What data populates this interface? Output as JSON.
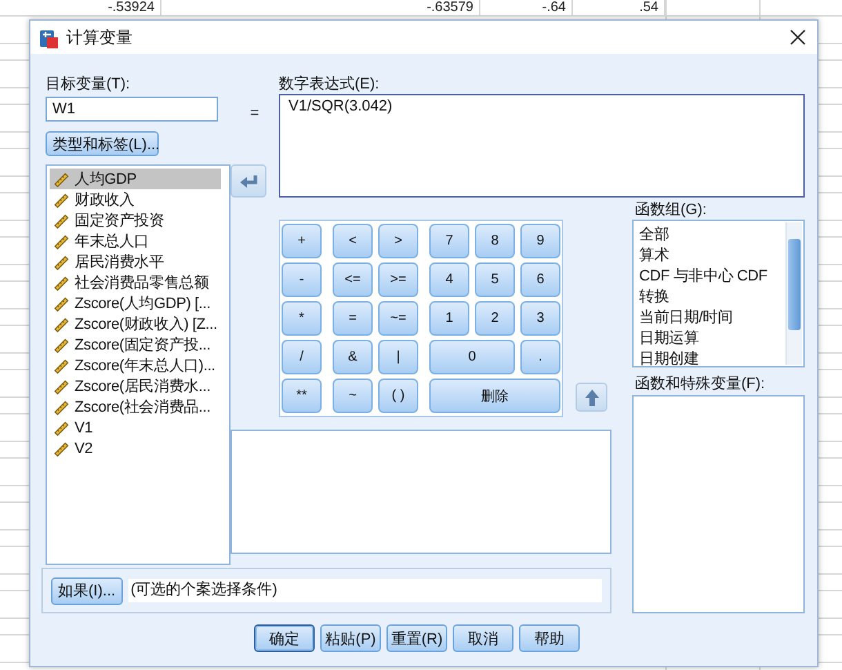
{
  "spreadsheet": {
    "cells": [
      "-.53924",
      "-.63579",
      "-.64",
      ".54"
    ]
  },
  "dialog": {
    "title": "计算变量",
    "target": {
      "label": "目标变量(T):",
      "value": "W1"
    },
    "equals": "=",
    "type_button": "类型和标签(L)...",
    "variables": [
      {
        "label": "人均GDP",
        "selected": true
      },
      {
        "label": "财政收入",
        "selected": false
      },
      {
        "label": "固定资产投资",
        "selected": false
      },
      {
        "label": "年末总人口",
        "selected": false
      },
      {
        "label": "居民消费水平",
        "selected": false
      },
      {
        "label": "社会消费品零售总额",
        "selected": false
      },
      {
        "label": "Zscore(人均GDP) [...",
        "selected": false
      },
      {
        "label": "Zscore(财政收入) [Z...",
        "selected": false
      },
      {
        "label": "Zscore(固定资产投...",
        "selected": false
      },
      {
        "label": "Zscore(年末总人口)...",
        "selected": false
      },
      {
        "label": "Zscore(居民消费水...",
        "selected": false
      },
      {
        "label": "Zscore(社会消费品...",
        "selected": false
      },
      {
        "label": "V1",
        "selected": false
      },
      {
        "label": "V2",
        "selected": false
      }
    ],
    "expression": {
      "label": "数字表达式(E):",
      "value": "V1/SQR(3.042)"
    },
    "keypad": {
      "operators": [
        "+",
        "<",
        ">",
        "-",
        "<=",
        ">=",
        "*",
        "=",
        "~=",
        "/",
        "&",
        "|",
        "**",
        "~",
        "( )"
      ],
      "digits": [
        {
          "label": "7",
          "kind": "single"
        },
        {
          "label": "8",
          "kind": "single"
        },
        {
          "label": "9",
          "kind": "single"
        },
        {
          "label": "4",
          "kind": "single"
        },
        {
          "label": "5",
          "kind": "single"
        },
        {
          "label": "6",
          "kind": "single"
        },
        {
          "label": "1",
          "kind": "single"
        },
        {
          "label": "2",
          "kind": "single"
        },
        {
          "label": "3",
          "kind": "single"
        },
        {
          "label": "0",
          "kind": "double"
        },
        {
          "label": ".",
          "kind": "single"
        },
        {
          "label": "删除",
          "kind": "triple"
        }
      ]
    },
    "function_group": {
      "label": "函数组(G):",
      "items": [
        {
          "label": "全部",
          "selected": false
        },
        {
          "label": "算术",
          "selected": false
        },
        {
          "label": "CDF 与非中心 CDF",
          "selected": false
        },
        {
          "label": "转换",
          "selected": false
        },
        {
          "label": "当前日期/时间",
          "selected": false
        },
        {
          "label": "日期运算",
          "selected": false
        },
        {
          "label": "日期创建",
          "selected": false
        }
      ]
    },
    "functions": {
      "label": "函数和特殊变量(F):"
    },
    "condition": {
      "button": "如果(I)...",
      "text": "(可选的个案选择条件)"
    },
    "buttons": [
      {
        "label": "确定",
        "default": true
      },
      {
        "label": "粘贴(P)",
        "default": false
      },
      {
        "label": "重置(R)",
        "default": false
      },
      {
        "label": "取消",
        "default": false
      },
      {
        "label": "帮助",
        "default": false
      }
    ]
  }
}
